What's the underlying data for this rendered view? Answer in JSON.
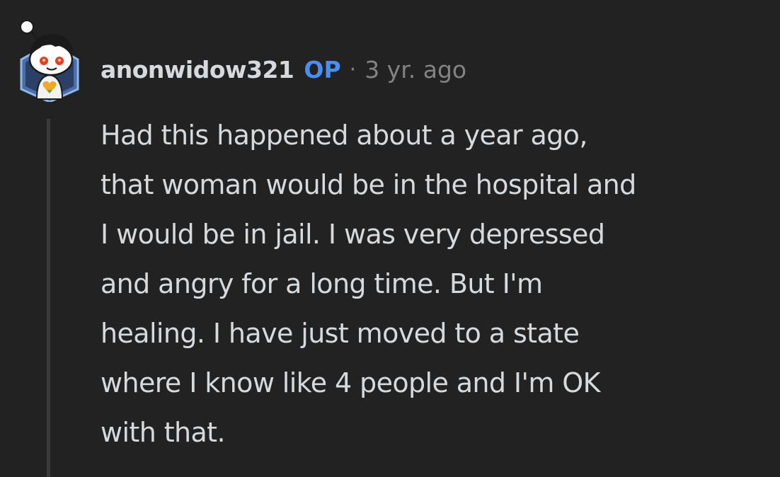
{
  "comment": {
    "author": "anonwidow321",
    "op_badge": "OP",
    "separator": "·",
    "timestamp": "3 yr. ago",
    "avatar_icon": "snoo-avatar-icon",
    "body_lines": [
      "Had this happened about a year ago,",
      "that woman would be in the hospital and",
      "I would be in jail. I was very depressed",
      "and angry for a long time. But I'm",
      "healing. I have just moved to a state",
      "where I know like 4 people and I'm OK",
      "with that."
    ]
  },
  "colors": {
    "background": "#222222",
    "text": "#d7dadc",
    "meta": "#818384",
    "op_badge": "#4a8ef0",
    "thread_line": "#3b3b3b"
  }
}
